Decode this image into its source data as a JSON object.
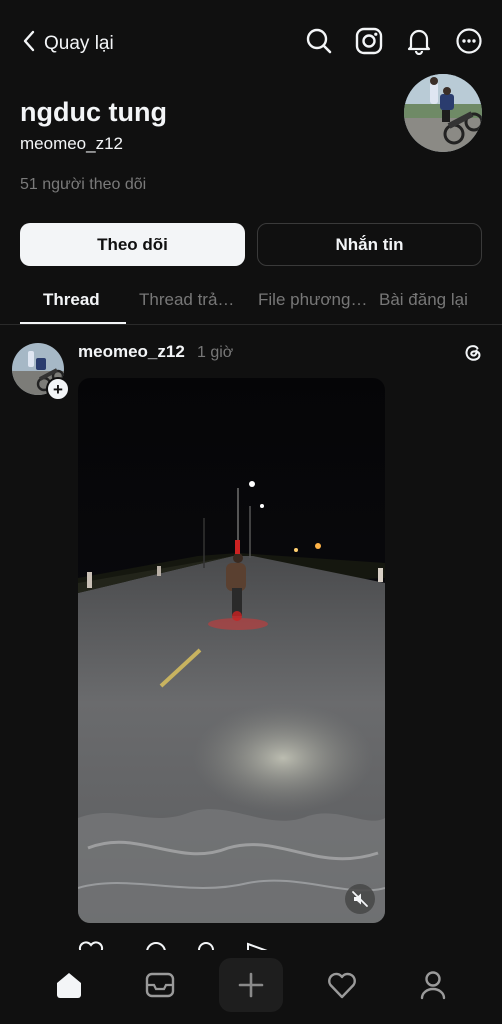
{
  "header": {
    "back_label": "Quay lại",
    "icons": [
      "search-icon",
      "instagram-icon",
      "notification-bell-icon",
      "more-options-icon"
    ]
  },
  "profile": {
    "name": "ngduc tung",
    "handle": "meomeo_z12",
    "followers": "51 người theo dõi"
  },
  "actions": {
    "follow_label": "Theo dõi",
    "message_label": "Nhắn tin"
  },
  "tabs": [
    {
      "label": "Thread",
      "active": true
    },
    {
      "label": "Thread trả…",
      "active": false
    },
    {
      "label": "File phương…",
      "active": false
    },
    {
      "label": "Bài đăng lại",
      "active": false
    }
  ],
  "post": {
    "username": "meomeo_z12",
    "time": "1 giờ",
    "media": "night road video of a motorbike rider doing a wheelie under street lights",
    "muted": true
  },
  "bottom_nav": [
    "home-icon",
    "messages-icon",
    "create-plus-icon",
    "activity-heart-icon",
    "profile-icon"
  ],
  "colors": {
    "background": "#101010",
    "text_primary": "#f3f5f7",
    "text_secondary": "#777777"
  }
}
